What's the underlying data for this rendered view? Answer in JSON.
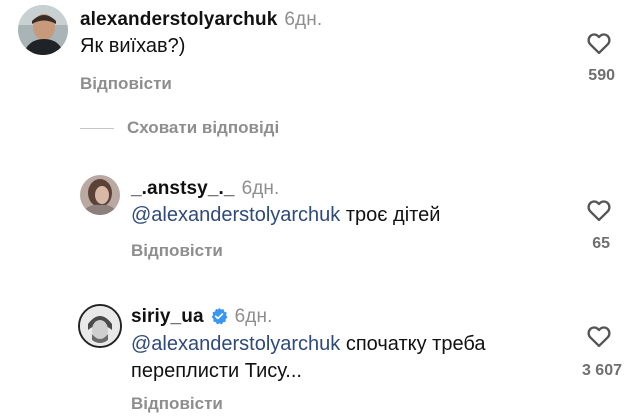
{
  "comment": {
    "username": "alexanderstolyarchuk",
    "time": "6дн.",
    "text": "Як виїхав?)",
    "reply_label": "Відповісти",
    "likes": "590"
  },
  "hide_replies_label": "Сховати відповіді",
  "replies": [
    {
      "username": "_.anstsy_._",
      "time": "6дн.",
      "mention": "@alexanderstolyarchuk",
      "text": " троє дітей",
      "reply_label": "Відповісти",
      "likes": "65"
    },
    {
      "username": "siriy_ua",
      "verified": true,
      "time": "6дн.",
      "mention": "@alexanderstolyarchuk",
      "text_line1": " спочатку треба",
      "text_line2": "переплисти Тису...",
      "reply_label": "Відповісти",
      "likes": "3 607"
    }
  ],
  "icons": {
    "like": "heart-outline-icon",
    "verified": "verified-badge-icon"
  },
  "colors": {
    "mention": "#2f4a7a",
    "secondary_text": "#8e8e8e",
    "verified_badge": "#3897f0"
  }
}
